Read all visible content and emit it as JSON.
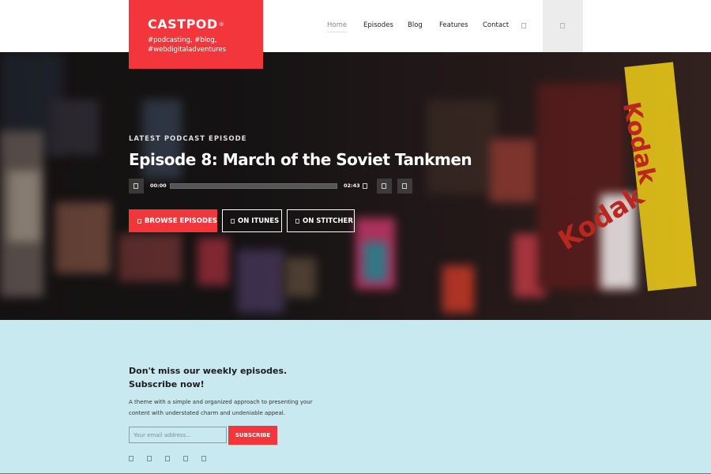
{
  "brand": {
    "name": "CASTPOD",
    "mark": "®",
    "tagline": "#podcasting, #blog, #webdigitaladventures",
    "accent": "#f2363c"
  },
  "nav": {
    "items": [
      {
        "label": "Home",
        "active": true
      },
      {
        "label": "Episodes",
        "active": false
      },
      {
        "label": "Blog",
        "active": false
      },
      {
        "label": "Features",
        "active": false
      },
      {
        "label": "Contact",
        "active": false
      }
    ],
    "search_icon": "search-icon",
    "panel_icon": "menu-icon"
  },
  "hero": {
    "eyebrow": "LATEST PODCAST EPISODE",
    "title": "Episode 8: March of the Soviet Tankmen",
    "player": {
      "current_time": "00:00",
      "duration": "02:43",
      "progress": 0
    },
    "buttons": {
      "browse": "BROWSE EPISODES",
      "itunes": "ON ITUNES",
      "stitcher": "ON STITCHER"
    }
  },
  "subscribe": {
    "title": "Don't miss our weekly episodes. Subscribe now!",
    "text": "A theme with a simple and organized approach to presenting your content with understated charm and undeniable appeal.",
    "placeholder": "Your email address...",
    "button": "SUBSCRIBE",
    "bg_color": "#c9e9f0",
    "social_icons": [
      "facebook-icon",
      "twitter-icon",
      "instagram-icon",
      "youtube-icon",
      "soundcloud-icon"
    ]
  }
}
